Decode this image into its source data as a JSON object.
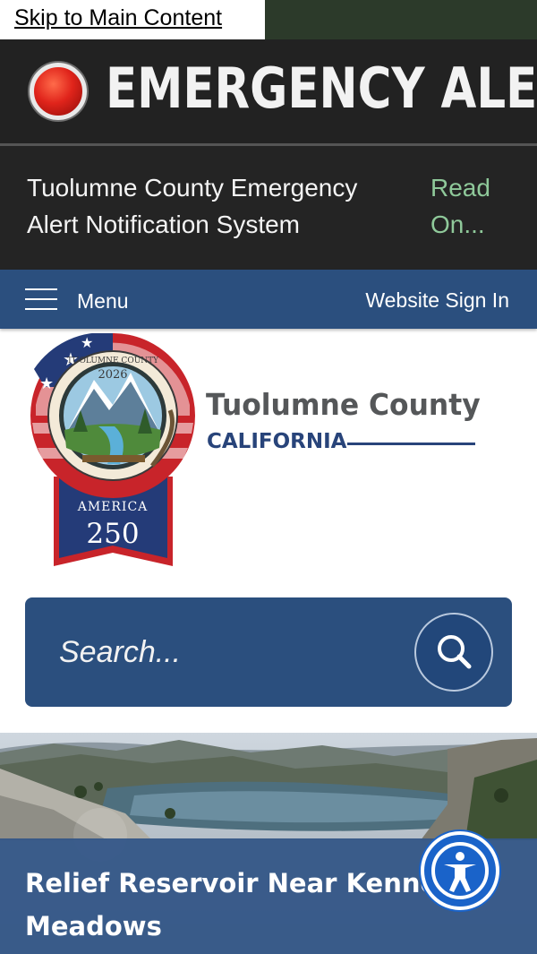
{
  "skip_link": "Skip to Main Content",
  "emergency": {
    "title": "EMERGENCY ALERT",
    "notice": "Tuolumne County Emergency Alert Notification System",
    "read_on": "Read On..."
  },
  "nav": {
    "menu_label": "Menu",
    "sign_in": "Website Sign In"
  },
  "logo": {
    "seal_text_top": "TUOLUMNE COUNTY",
    "seal_year": "2026",
    "ribbon_text": "AMERICA",
    "ribbon_number": "250",
    "county_name": "Tuolumne County",
    "state": "CALIFORNIA"
  },
  "search": {
    "placeholder": "Search..."
  },
  "hero": {
    "title": "Relief Reservoir Near Kennedy Meadows"
  },
  "icons": {
    "alert": "red-alert-light-icon",
    "menu": "hamburger-menu-icon",
    "search": "magnifier-icon",
    "accessibility": "accessibility-person-icon"
  },
  "colors": {
    "nav_blue": "#2b4f7e",
    "alert_red": "#e0241b",
    "read_on_green": "#8fc99a",
    "accessibility_blue": "#1a63c9"
  }
}
